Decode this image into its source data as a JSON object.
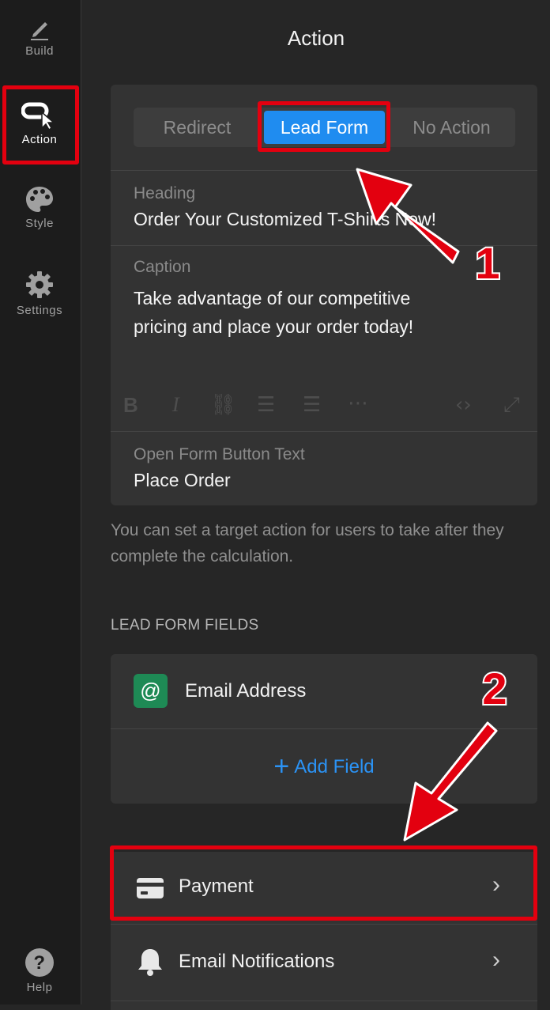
{
  "sidebar": {
    "items": [
      {
        "label": "Build",
        "icon": "pencil-icon"
      },
      {
        "label": "Action",
        "icon": "cursor-action-icon",
        "active": true
      },
      {
        "label": "Style",
        "icon": "palette-icon"
      },
      {
        "label": "Settings",
        "icon": "gear-icon"
      }
    ],
    "help_label": "Help"
  },
  "header": {
    "title": "Action"
  },
  "action_tabs": {
    "options": [
      "Redirect",
      "Lead Form",
      "No Action"
    ],
    "selected": "Lead Form"
  },
  "form": {
    "heading_label": "Heading",
    "heading_value": "Order Your Customized T-Shirts Now!",
    "caption_label": "Caption",
    "caption_value_line1": "Take advantage of our competitive",
    "caption_value_line2": "pricing and place your order today!",
    "button_text_label": "Open Form Button Text",
    "button_text_value": "Place Order"
  },
  "hint_text": "You can set a target action for users to take after they complete the calculation.",
  "lead_fields": {
    "section_title": "LEAD FORM FIELDS",
    "fields": [
      {
        "label": "Email Address",
        "icon": "at-icon"
      }
    ],
    "add_field_label": "Add Field"
  },
  "settings_rows": [
    {
      "label": "Payment",
      "icon": "credit-card-icon"
    },
    {
      "label": "Email Notifications",
      "icon": "bell-icon"
    }
  ],
  "annotations": {
    "step1": "1",
    "step2": "2"
  },
  "colors": {
    "accent": "#1f8cf0",
    "highlight": "#e3000f",
    "field_icon_bg": "#1e8a55"
  }
}
